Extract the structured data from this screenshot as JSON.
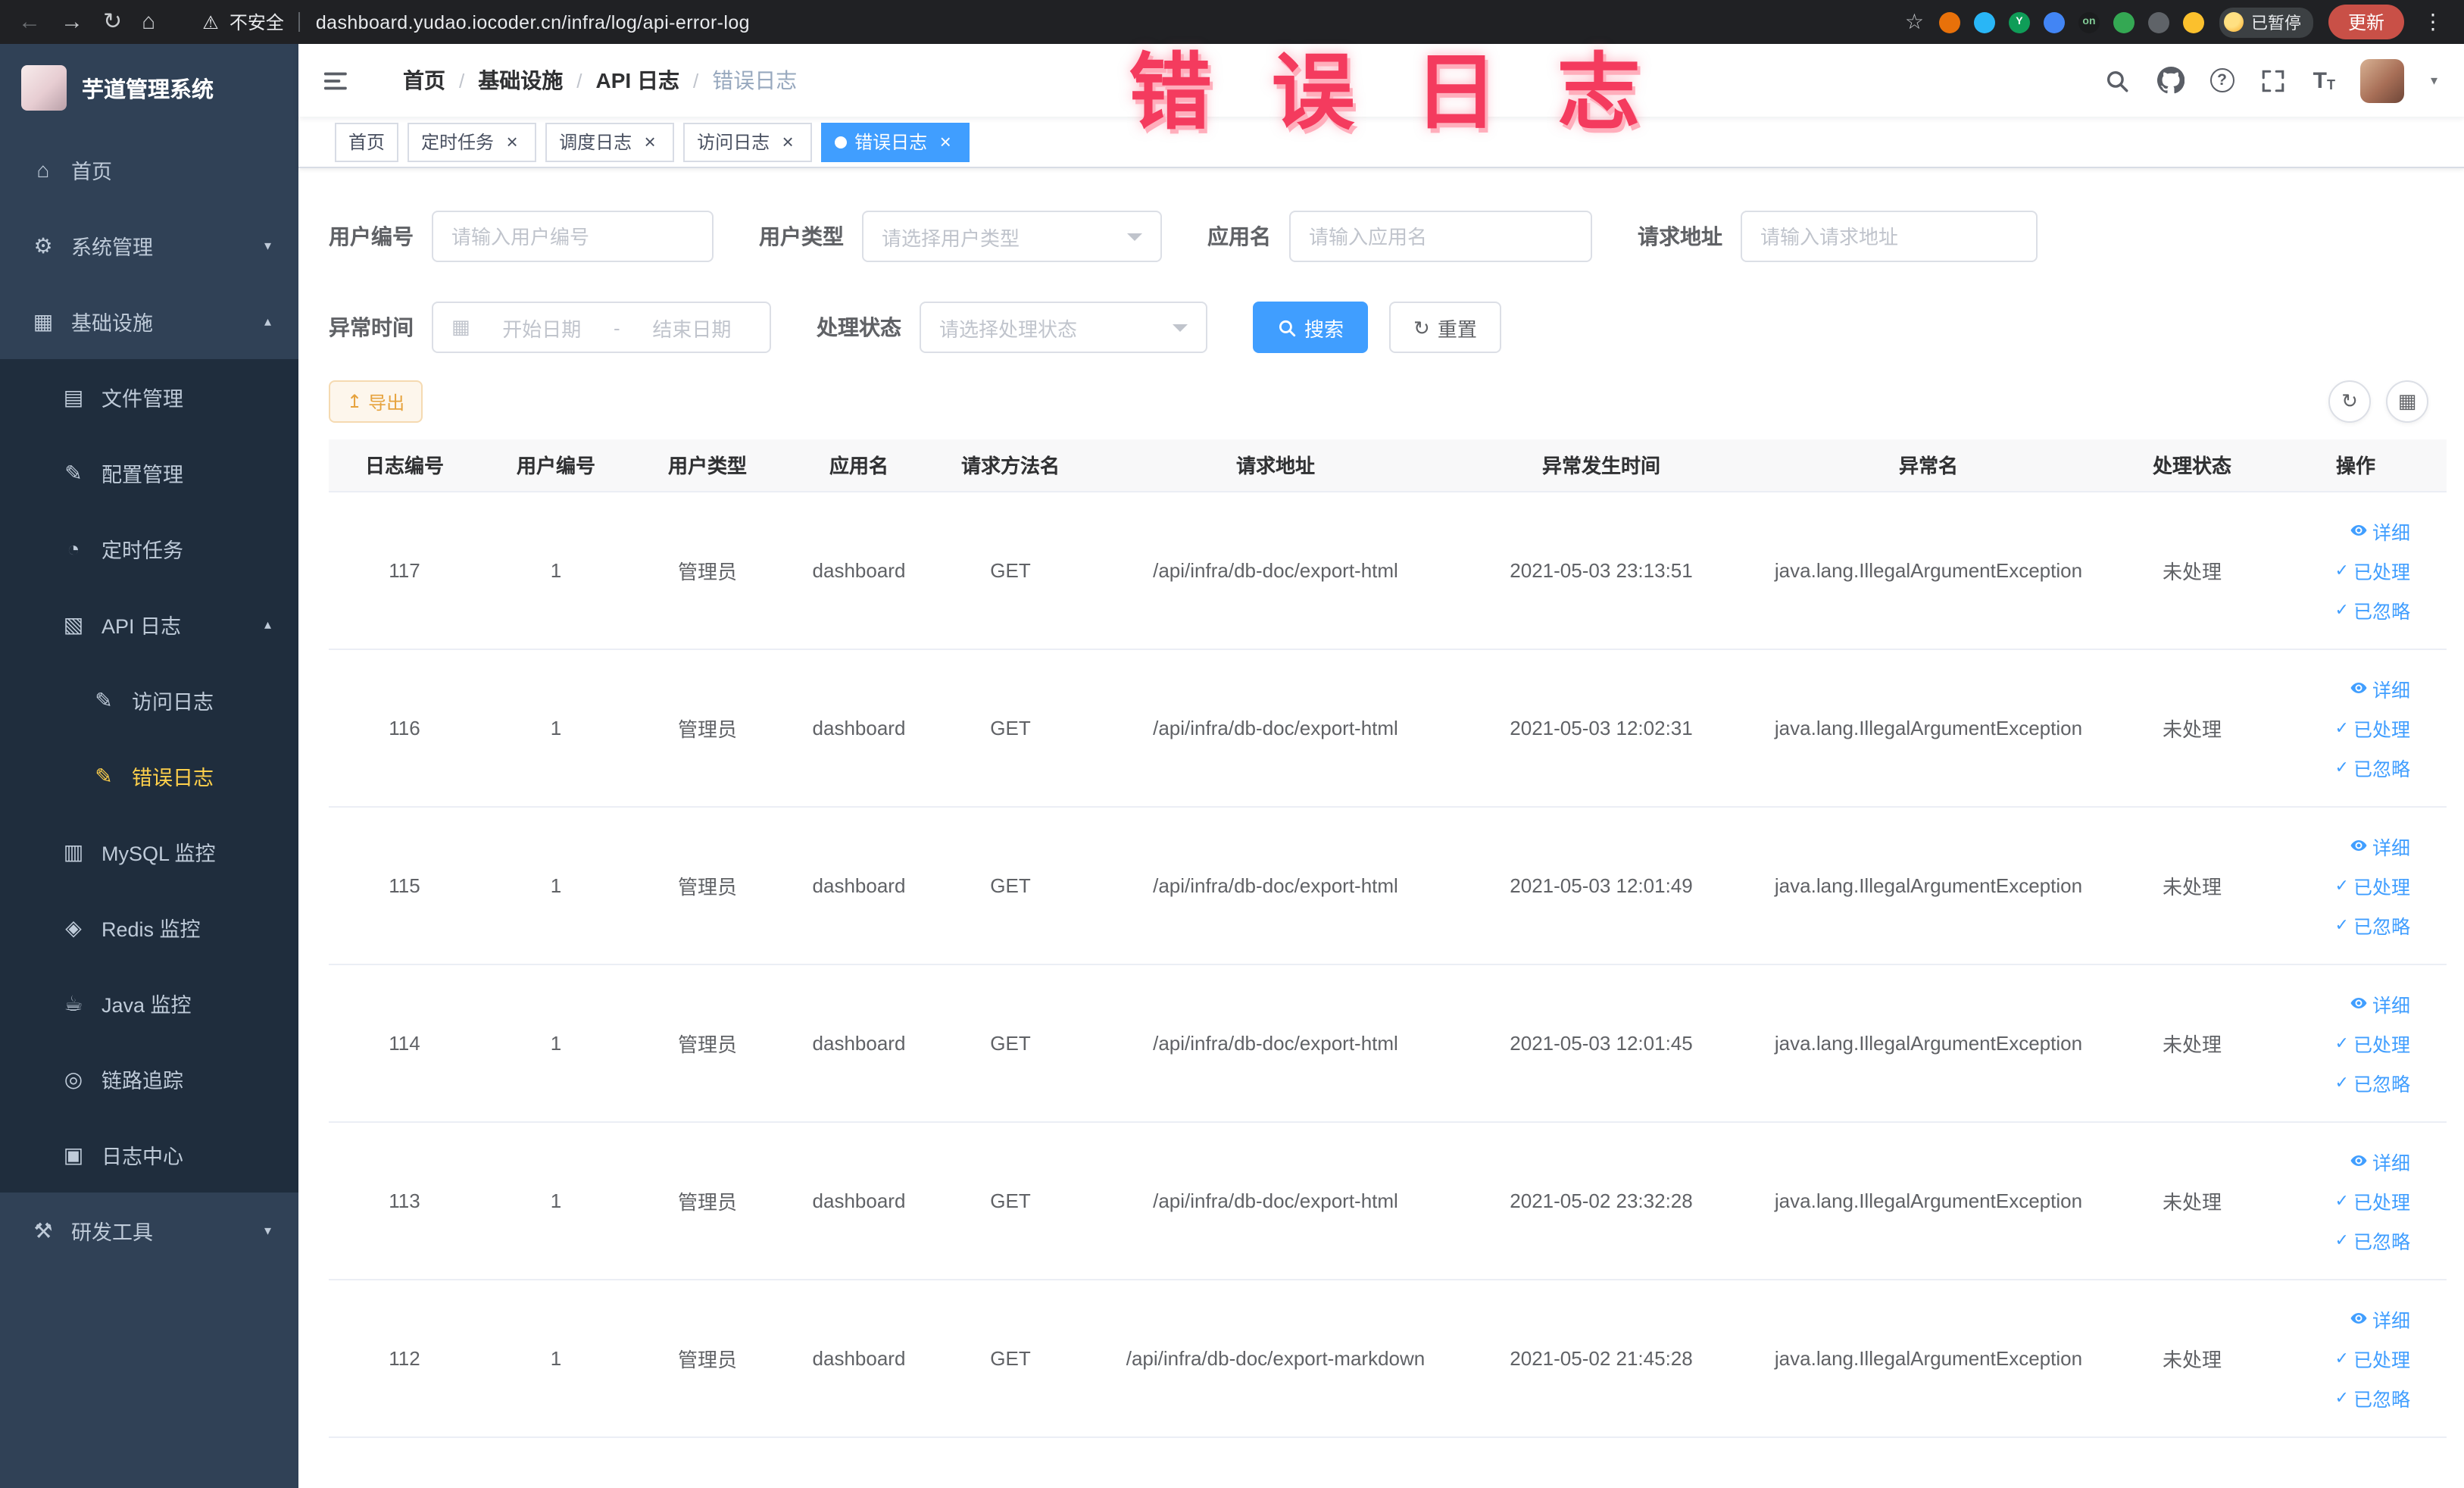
{
  "browser": {
    "back_glyph": "←",
    "forward_glyph": "→",
    "reload_glyph": "↻",
    "home_glyph": "⌂",
    "warning_glyph": "⚠",
    "security_label": "不安全",
    "url": "dashboard.yudao.iocoder.cn/infra/log/api-error-log",
    "star_glyph": "☆",
    "extensions": [
      {
        "color": "#e8710a"
      },
      {
        "color": "#29b6f6"
      },
      {
        "color": "#0f9d58",
        "glyph": "Y"
      },
      {
        "color": "#4285f4"
      },
      {
        "color": "#1b1c1e",
        "glyph": "on",
        "glyph_color": "#81c995"
      },
      {
        "color": "#34a853"
      },
      {
        "color": "#5f6368"
      },
      {
        "color": "#fbc02d"
      }
    ],
    "paused_label": "已暂停",
    "update_label": "更新",
    "kebab_glyph": "⋮"
  },
  "overlay": {
    "title": "错 误 日 志"
  },
  "sidebar": {
    "app_title": "芋道管理系统",
    "items": [
      {
        "label": "首页",
        "level": 0,
        "icon": "home-icon",
        "glyph": "⌂",
        "arrow": ""
      },
      {
        "label": "系统管理",
        "level": 0,
        "icon": "gear-icon",
        "glyph": "⚙",
        "arrow": "▾"
      },
      {
        "label": "基础设施",
        "level": 0,
        "icon": "infrastructure-icon",
        "glyph": "▦",
        "arrow": "▴"
      },
      {
        "label": "文件管理",
        "level": 1,
        "icon": "file-manage-icon",
        "glyph": "▤",
        "arrow": ""
      },
      {
        "label": "配置管理",
        "level": 1,
        "icon": "config-manage-icon",
        "glyph": "✎",
        "arrow": ""
      },
      {
        "label": "定时任务",
        "level": 1,
        "icon": "schedule-job-icon",
        "glyph": "◔",
        "arrow": ""
      },
      {
        "label": "API 日志",
        "level": 1,
        "icon": "api-log-icon",
        "glyph": "▧",
        "arrow": "▴"
      },
      {
        "label": "访问日志",
        "level": 2,
        "icon": "access-log-icon",
        "glyph": "✎",
        "arrow": ""
      },
      {
        "label": "错误日志",
        "level": 2,
        "icon": "error-log-icon",
        "glyph": "✎",
        "arrow": "",
        "active": true
      },
      {
        "label": "MySQL 监控",
        "level": 1,
        "icon": "mysql-monitor-icon",
        "glyph": "▥",
        "arrow": ""
      },
      {
        "label": "Redis 监控",
        "level": 1,
        "icon": "redis-monitor-icon",
        "glyph": "◈",
        "arrow": ""
      },
      {
        "label": "Java 监控",
        "level": 1,
        "icon": "java-monitor-icon",
        "glyph": "☕",
        "arrow": ""
      },
      {
        "label": "链路追踪",
        "level": 1,
        "icon": "trace-icon",
        "glyph": "◎",
        "arrow": ""
      },
      {
        "label": "日志中心",
        "level": 1,
        "icon": "log-center-icon",
        "glyph": "▣",
        "arrow": ""
      },
      {
        "label": "研发工具",
        "level": 0,
        "icon": "devtools-icon",
        "glyph": "⚒",
        "arrow": "▾"
      }
    ]
  },
  "header": {
    "breadcrumb": [
      {
        "label": "首页",
        "sep": ""
      },
      {
        "label": "基础设施",
        "sep": "/"
      },
      {
        "label": "API 日志",
        "sep": "/"
      },
      {
        "label": "错误日志",
        "sep": "/",
        "muted": true
      }
    ],
    "help_glyph": "?",
    "font_large_glyph": "T",
    "font_small_glyph": "T",
    "avatar_caret_glyph": "▾"
  },
  "tags": {
    "close_glyph": "×",
    "items": [
      {
        "label": "首页",
        "closable": false,
        "active": false
      },
      {
        "label": "定时任务",
        "closable": true,
        "active": false
      },
      {
        "label": "调度日志",
        "closable": true,
        "active": false
      },
      {
        "label": "访问日志",
        "closable": true,
        "active": false
      },
      {
        "label": "错误日志",
        "closable": true,
        "active": true
      }
    ]
  },
  "filters": {
    "user_id": {
      "label": "用户编号",
      "placeholder": "请输入用户编号"
    },
    "user_type": {
      "label": "用户类型",
      "placeholder": "请选择用户类型"
    },
    "app_name": {
      "label": "应用名",
      "placeholder": "请输入应用名"
    },
    "request_url": {
      "label": "请求地址",
      "placeholder": "请输入请求地址"
    },
    "exception_time": {
      "label": "异常时间",
      "start_placeholder": "开始日期",
      "separator": "-",
      "end_placeholder": "结束日期"
    },
    "process_status": {
      "label": "处理状态",
      "placeholder": "请选择处理状态"
    },
    "search_label": "搜索",
    "reset_label": "重置"
  },
  "toolbar": {
    "export_label": "导出"
  },
  "icons": {
    "calendar": "▦",
    "check": "✓",
    "refresh": "↻",
    "export": "↥",
    "columns": "▦"
  },
  "table": {
    "columns": [
      {
        "label": "日志编号"
      },
      {
        "label": "用户编号"
      },
      {
        "label": "用户类型"
      },
      {
        "label": "应用名"
      },
      {
        "label": "请求方法名"
      },
      {
        "label": "请求地址"
      },
      {
        "label": "异常发生时间"
      },
      {
        "label": "异常名"
      },
      {
        "label": "处理状态"
      },
      {
        "label": "操作"
      }
    ],
    "action_labels": {
      "detail": "详细",
      "done": "已处理",
      "ignore": "已忽略"
    },
    "rows": [
      {
        "id": "117",
        "user_id": "1",
        "user_type": "管理员",
        "app": "dashboard",
        "method": "GET",
        "url": "/api/infra/db-doc/export-html",
        "time": "2021-05-03 23:13:51",
        "exception": "java.lang.IllegalArgumentException",
        "status": "未处理"
      },
      {
        "id": "116",
        "user_id": "1",
        "user_type": "管理员",
        "app": "dashboard",
        "method": "GET",
        "url": "/api/infra/db-doc/export-html",
        "time": "2021-05-03 12:02:31",
        "exception": "java.lang.IllegalArgumentException",
        "status": "未处理"
      },
      {
        "id": "115",
        "user_id": "1",
        "user_type": "管理员",
        "app": "dashboard",
        "method": "GET",
        "url": "/api/infra/db-doc/export-html",
        "time": "2021-05-03 12:01:49",
        "exception": "java.lang.IllegalArgumentException",
        "status": "未处理"
      },
      {
        "id": "114",
        "user_id": "1",
        "user_type": "管理员",
        "app": "dashboard",
        "method": "GET",
        "url": "/api/infra/db-doc/export-html",
        "time": "2021-05-03 12:01:45",
        "exception": "java.lang.IllegalArgumentException",
        "status": "未处理"
      },
      {
        "id": "113",
        "user_id": "1",
        "user_type": "管理员",
        "app": "dashboard",
        "method": "GET",
        "url": "/api/infra/db-doc/export-html",
        "time": "2021-05-02 23:32:28",
        "exception": "java.lang.IllegalArgumentException",
        "status": "未处理"
      },
      {
        "id": "112",
        "user_id": "1",
        "user_type": "管理员",
        "app": "dashboard",
        "method": "GET",
        "url": "/api/infra/db-doc/export-markdown",
        "time": "2021-05-02 21:45:28",
        "exception": "java.lang.IllegalArgumentException",
        "status": "未处理"
      }
    ]
  }
}
